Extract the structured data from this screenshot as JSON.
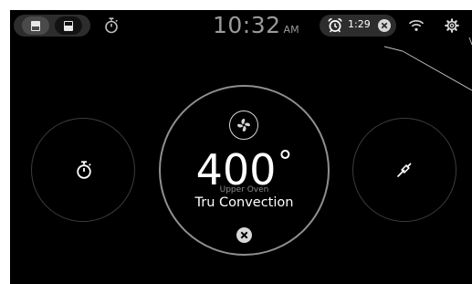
{
  "status_bar": {
    "clock_time": "10:32",
    "clock_ampm": "AM",
    "alarm_time": "1:29",
    "icons": [
      "upper-oven-icon",
      "lower-oven-icon",
      "timer-icon",
      "alarm-clock-icon",
      "close-icon",
      "wifi-icon",
      "gear-icon"
    ]
  },
  "oven": {
    "temperature": "400",
    "degree_symbol": "°",
    "oven_name": "Upper Oven",
    "mode": "Tru Convection"
  },
  "controls": {
    "left_button_icon": "timer-icon",
    "right_button_icon": "probe-icon",
    "center_top_icon": "fan-icon",
    "center_bottom_icon": "close-icon"
  },
  "colors": {
    "background": "#000000",
    "text_primary": "#ffffff",
    "text_secondary": "#9a9a9a",
    "pill": "#2d2d2d"
  }
}
